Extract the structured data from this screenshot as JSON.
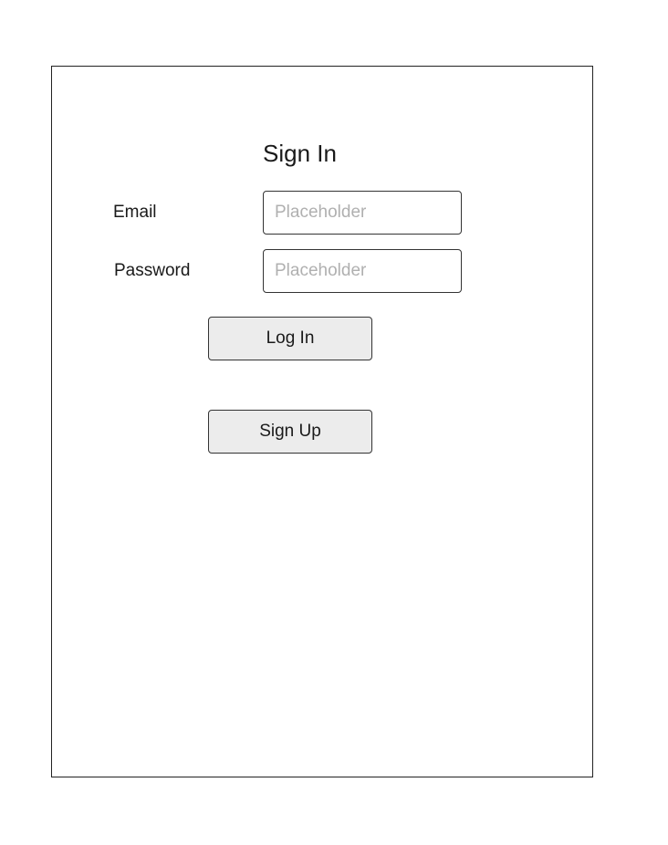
{
  "form": {
    "title": "Sign In",
    "email": {
      "label": "Email",
      "placeholder": "Placeholder",
      "value": ""
    },
    "password": {
      "label": "Password",
      "placeholder": "Placeholder",
      "value": ""
    },
    "login_label": "Log In",
    "signup_label": "Sign Up"
  }
}
